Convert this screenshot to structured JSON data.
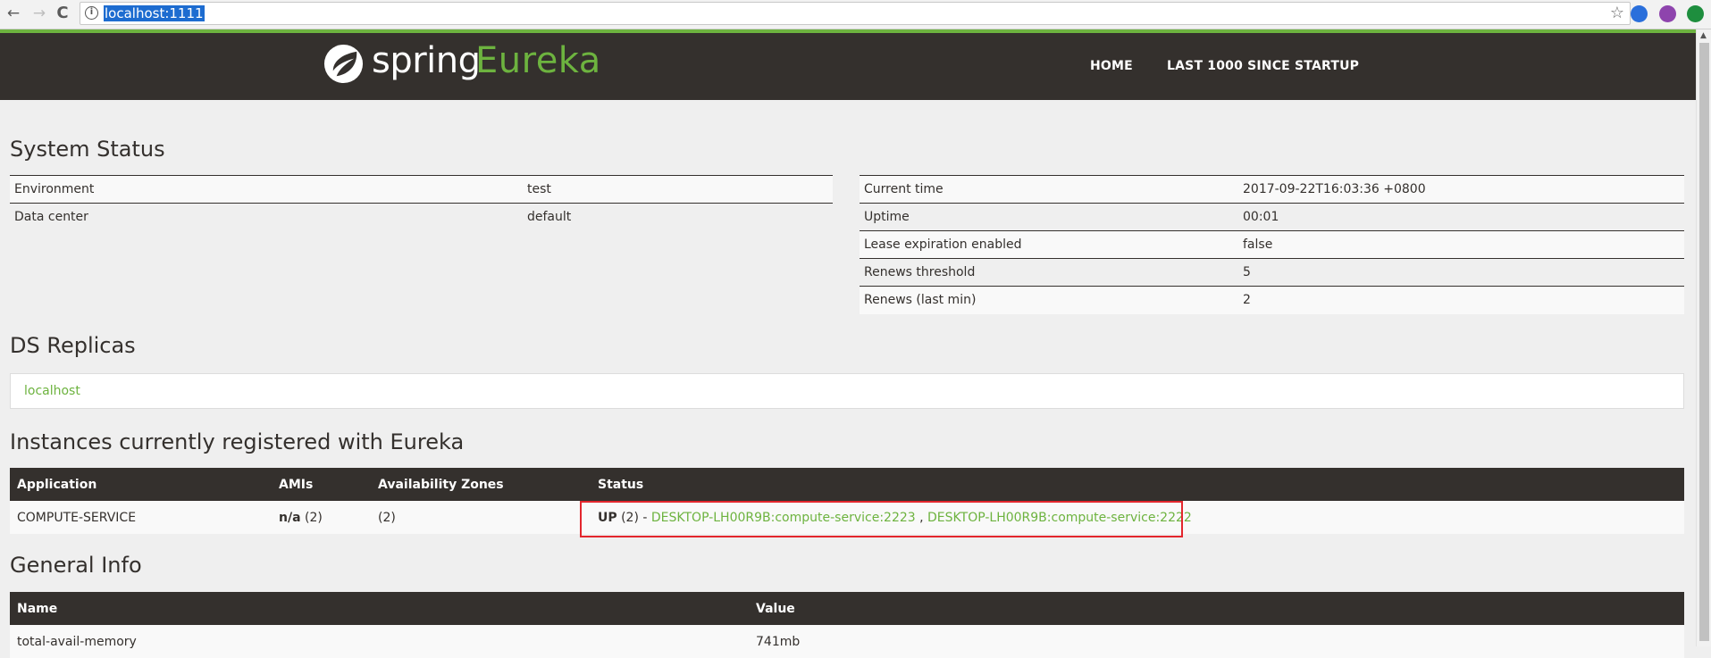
{
  "browser": {
    "url": "localhost:1111",
    "back_glyph": "←",
    "forward_glyph": "→",
    "reload_glyph": "C",
    "info_glyph": "i",
    "star_glyph": "☆",
    "extension_icons": [
      "chrome-extension-icon-blue",
      "chrome-extension-icon-purple",
      "chrome-extension-icon-green"
    ]
  },
  "header": {
    "brand_spring": "spring",
    "brand_eureka": "Eureka",
    "nav": [
      "HOME",
      "LAST 1000 SINCE STARTUP"
    ],
    "accent_color": "#6db33f",
    "bar_color": "#34302d"
  },
  "system_status": {
    "title": "System Status",
    "left": [
      {
        "key": "Environment",
        "value": "test"
      },
      {
        "key": "Data center",
        "value": "default"
      }
    ],
    "right": [
      {
        "key": "Current time",
        "value": "2017-09-22T16:03:36 +0800"
      },
      {
        "key": "Uptime",
        "value": "00:01"
      },
      {
        "key": "Lease expiration enabled",
        "value": "false"
      },
      {
        "key": "Renews threshold",
        "value": "5"
      },
      {
        "key": "Renews (last min)",
        "value": "2"
      }
    ]
  },
  "ds_replicas": {
    "title": "DS Replicas",
    "items": [
      "localhost"
    ]
  },
  "instances": {
    "title": "Instances currently registered with Eureka",
    "columns": [
      "Application",
      "AMIs",
      "Availability Zones",
      "Status"
    ],
    "rows": [
      {
        "application": "COMPUTE-SERVICE",
        "amis_label": "n/a",
        "amis_count": "(2)",
        "zones": "(2)",
        "status_label": "UP",
        "status_count": "(2)",
        "status_sep": " - ",
        "instances": [
          "DESKTOP-LH00R9B:compute-service:2223",
          "DESKTOP-LH00R9B:compute-service:2222"
        ],
        "instance_sep": " , "
      }
    ],
    "highlight_color": "#e3262d"
  },
  "general_info": {
    "title": "General Info",
    "columns": [
      "Name",
      "Value"
    ],
    "rows": [
      {
        "name": "total-avail-memory",
        "value": "741mb"
      }
    ]
  }
}
